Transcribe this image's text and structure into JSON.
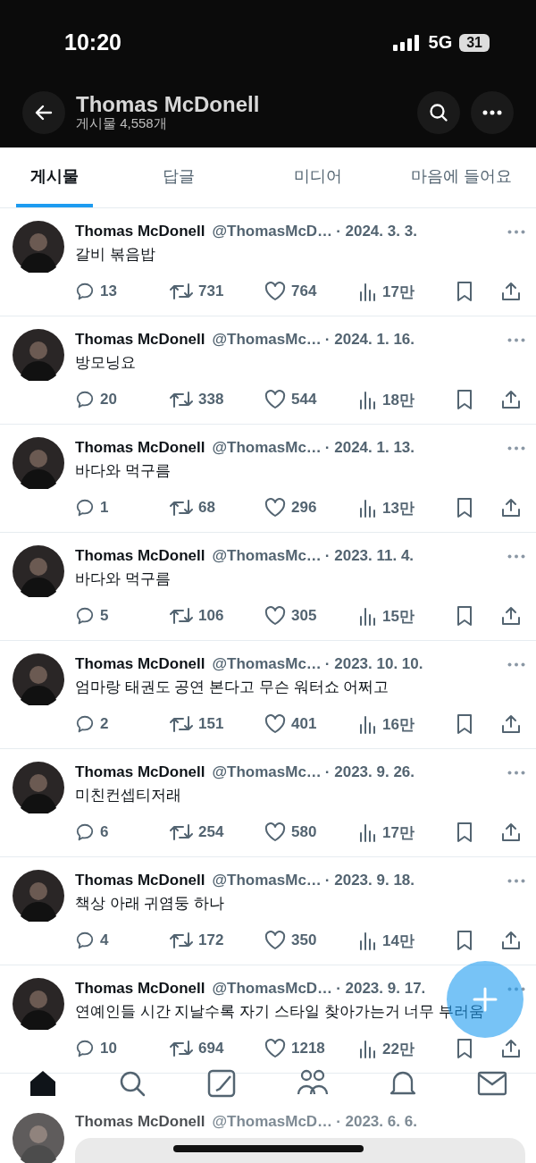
{
  "status_bar": {
    "time": "10:20",
    "network": "5G",
    "battery": "31"
  },
  "header": {
    "name": "Thomas McDonell",
    "post_count": "게시물 4,558개"
  },
  "tabs": [
    {
      "label": "게시물",
      "selected": true
    },
    {
      "label": "답글",
      "selected": false
    },
    {
      "label": "미디어",
      "selected": false
    },
    {
      "label": "마음에 들어요",
      "selected": false
    }
  ],
  "posts": [
    {
      "name": "Thomas McDonell",
      "handle": "@ThomasMcD…",
      "date": "· 2024. 3. 3.",
      "text": "갈비 볶음밥",
      "replies": "13",
      "reposts": "731",
      "likes": "764",
      "views": "17만"
    },
    {
      "name": "Thomas McDonell",
      "handle": "@ThomasMc…",
      "date": "· 2024. 1. 16.",
      "text": "방모닝요",
      "replies": "20",
      "reposts": "338",
      "likes": "544",
      "views": "18만"
    },
    {
      "name": "Thomas McDonell",
      "handle": "@ThomasMc…",
      "date": "· 2024. 1. 13.",
      "text": "바다와 먹구름",
      "replies": "1",
      "reposts": "68",
      "likes": "296",
      "views": "13만"
    },
    {
      "name": "Thomas McDonell",
      "handle": "@ThomasMc…",
      "date": "· 2023. 11. 4.",
      "text": "바다와 먹구름",
      "replies": "5",
      "reposts": "106",
      "likes": "305",
      "views": "15만"
    },
    {
      "name": "Thomas McDonell",
      "handle": "@ThomasMc…",
      "date": "· 2023. 10. 10.",
      "text": "엄마랑 태권도 공연 본다고 무슨 워터쇼 어쩌고",
      "replies": "2",
      "reposts": "151",
      "likes": "401",
      "views": "16만"
    },
    {
      "name": "Thomas McDonell",
      "handle": "@ThomasMc…",
      "date": "· 2023. 9. 26.",
      "text": "미친컨셉티저래",
      "replies": "6",
      "reposts": "254",
      "likes": "580",
      "views": "17만"
    },
    {
      "name": "Thomas McDonell",
      "handle": "@ThomasMc…",
      "date": "· 2023. 9. 18.",
      "text": "책상 아래 귀염둥 하나",
      "replies": "4",
      "reposts": "172",
      "likes": "350",
      "views": "14만"
    },
    {
      "name": "Thomas McDonell",
      "handle": "@ThomasMcD…",
      "date": "· 2023. 9. 17.",
      "text": "연예인들 시간 지날수록 자기 스타일 찾아가는거 너무 부러움",
      "replies": "10",
      "reposts": "694",
      "likes": "1218",
      "views": "22만"
    }
  ],
  "partial_post": {
    "name": "Thomas McDonell",
    "handle": "@ThomasMcD…",
    "date": "· 2023. 6. 6."
  }
}
